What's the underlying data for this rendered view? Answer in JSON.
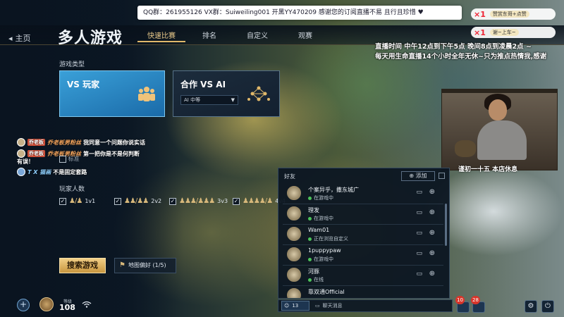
{
  "overlay": {
    "banner": "QQ群：261955126 VX群：Suiweiling001 开黑YY470209 感谢您的订阅直播不易 且行且珍惜 ♥",
    "gifts": [
      {
        "mult": "×1",
        "tag": "赞赏东哥+点赞"
      },
      {
        "mult": "×1",
        "tag": "谢~上车~"
      }
    ],
    "live_lines": [
      "直播时间 中午12点到下午5点 晚间8点到凌晨2点 ~",
      "每天用生命直播14个小时全年无休~只为推点热情我,感谢"
    ],
    "webcam_caption": "谨初一十五 本店休息"
  },
  "nav": {
    "home": "主页",
    "title": "多人游戏",
    "tabs": [
      "快速比赛",
      "排名",
      "自定义",
      "观赛"
    ]
  },
  "game_type": {
    "label": "游戏类型",
    "vs_player": "VS 玩家",
    "vs_ai": "合作 VS AI",
    "ai_difficulty": "AI 中等"
  },
  "chat_feed": [
    {
      "badge": "乔老板",
      "name": "乔老板男粉丝",
      "text": "我同意一个问题你说实话"
    },
    {
      "badge": "乔老板",
      "name": "乔老板男粉丝",
      "text": "第一把你是不是何判断",
      "cont": "有误！"
    },
    {
      "badge": "T",
      "name": "T X 猫画",
      "text": "不是固定套路"
    }
  ],
  "faint": {
    "marker": "标准"
  },
  "player_count": {
    "label": "玩家人数",
    "options": [
      "1v1",
      "2v2",
      "3v3",
      "4v4"
    ]
  },
  "actions": {
    "search": "搜索游戏",
    "map_pref": "地图偏好 (1/5)"
  },
  "profile": {
    "level_label": "等级",
    "level": "108"
  },
  "friends": {
    "title": "好友",
    "add": "添加",
    "list": [
      {
        "name": "个案异乎，撒东城广",
        "status": "在游戏中"
      },
      {
        "name": "理发",
        "status": "在游戏中"
      },
      {
        "name": "Wam01",
        "status": "正在浏览自定义"
      },
      {
        "name": "1puppypaw",
        "status": "在游戏中"
      },
      {
        "name": "河豚",
        "status": "在线"
      },
      {
        "name": "靠双通Official",
        "status": ""
      }
    ]
  },
  "chat_bar": {
    "friends_online": "13",
    "placeholder": "聊天消息"
  },
  "notifications": {
    "left": "10",
    "right": "28"
  },
  "colors": {
    "accent": "#e0b86a",
    "vs_player": "#3aa0d8",
    "online": "#4cc35a"
  }
}
